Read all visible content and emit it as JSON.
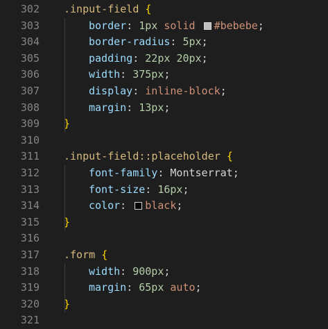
{
  "line_numbers": [
    "302",
    "303",
    "304",
    "305",
    "306",
    "307",
    "308",
    "309",
    "310",
    "311",
    "312",
    "313",
    "314",
    "315",
    "316",
    "317",
    "318",
    "319",
    "320",
    "321"
  ],
  "code": {
    "rule1": {
      "selector": ".input-field",
      "open": "{",
      "close": "}",
      "decls": [
        {
          "prop": "border",
          "parts": [
            {
              "t": "num",
              "v": "1px"
            },
            {
              "t": "val",
              "v": " solid "
            },
            {
              "t": "swatch",
              "color": "#bebebe"
            },
            {
              "t": "val",
              "v": "#bebebe"
            }
          ]
        },
        {
          "prop": "border-radius",
          "parts": [
            {
              "t": "num",
              "v": "5px"
            }
          ]
        },
        {
          "prop": "padding",
          "parts": [
            {
              "t": "num",
              "v": "22px"
            },
            {
              "t": "val",
              "v": " "
            },
            {
              "t": "num",
              "v": "20px"
            }
          ]
        },
        {
          "prop": "width",
          "parts": [
            {
              "t": "num",
              "v": "375px"
            }
          ]
        },
        {
          "prop": "display",
          "parts": [
            {
              "t": "val",
              "v": "inline-block"
            }
          ]
        },
        {
          "prop": "margin",
          "parts": [
            {
              "t": "num",
              "v": "13px"
            }
          ]
        }
      ]
    },
    "rule2": {
      "selector": ".input-field::placeholder",
      "open": "{",
      "close": "}",
      "decls": [
        {
          "prop": "font-family",
          "parts": [
            {
              "t": "plain",
              "v": "Montserrat"
            }
          ]
        },
        {
          "prop": "font-size",
          "parts": [
            {
              "t": "num",
              "v": "16px"
            }
          ]
        },
        {
          "prop": "color",
          "parts": [
            {
              "t": "swatch",
              "color": "#000000"
            },
            {
              "t": "val",
              "v": "black"
            }
          ]
        }
      ]
    },
    "rule3": {
      "selector": ".form",
      "open": "{",
      "close": "}",
      "decls": [
        {
          "prop": "width",
          "parts": [
            {
              "t": "num",
              "v": "900px"
            }
          ]
        },
        {
          "prop": "margin",
          "parts": [
            {
              "t": "num",
              "v": "65px"
            },
            {
              "t": "val",
              "v": " auto"
            }
          ]
        }
      ]
    }
  },
  "colors": {
    "background": "#1e1e1e",
    "line_number": "#858585",
    "selector": "#d7ba7d",
    "brace": "#ffd700",
    "property": "#9cdcfe",
    "number": "#b5cea8",
    "string_value": "#ce9178"
  }
}
